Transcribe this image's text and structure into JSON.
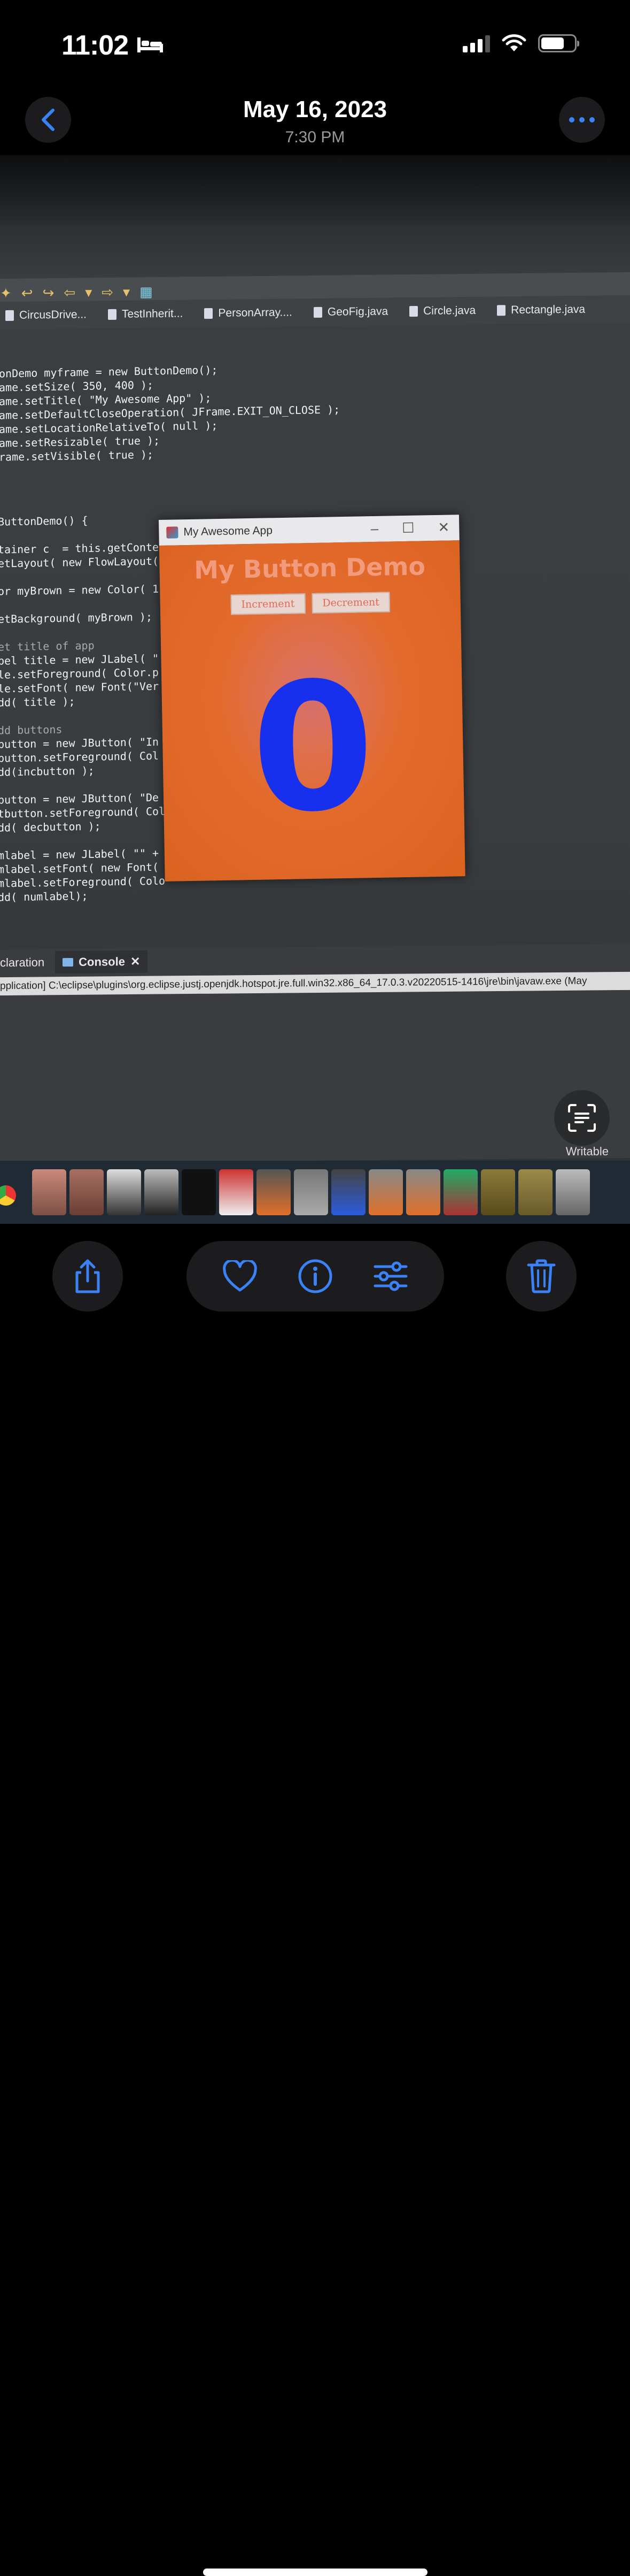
{
  "status_bar": {
    "time": "11:02"
  },
  "header": {
    "date": "May 16, 2023",
    "time": "7:30 PM"
  },
  "photo": {
    "ide_tabs": [
      "CircusDrive...",
      "TestInherit...",
      "PersonArray....",
      "GeoFig.java",
      "Circle.java",
      "Rectangle.java"
    ],
    "code_top": [
      "onDemo myframe = new ButtonDemo();",
      "ame.setSize( 350, 400 );",
      "ame.setTitle( \"My Awesome App\" );",
      "ame.setDefaultCloseOperation( JFrame.EXIT_ON_CLOSE );",
      "ame.setLocationRelativeTo( null );",
      "ame.setResizable( true );",
      "rame.setVisible( true );"
    ],
    "code_left": [
      "ButtonDemo() {",
      "",
      "tainer c  = this.getConte",
      "etLayout( new FlowLayout(",
      "",
      "or myBrown = new Color( 1",
      "",
      "etBackground( myBrown );",
      "",
      "et title of app",
      "bel title = new JLabel( \"",
      "le.setForeground( Color.p",
      "le.setFont( new Font(\"Ver",
      "dd( title );",
      "",
      "dd buttons",
      "button = new JButton( \"In",
      "button.setForeground( Col",
      "dd(incbutton );",
      "",
      "button = new JButton( \"De",
      "tbutton.setForeground( Col",
      "dd( decbutton );",
      "",
      "mlabel = new JLabel( \"\" + ",
      "mlabel.setFont( new Font(",
      "mlabel.setForeground( Colo",
      "dd( numlabel);"
    ],
    "java_window": {
      "title": "My Awesome App",
      "heading": "My Button Demo",
      "increment_label": "Increment",
      "decrement_label": "Decrement",
      "number": "0"
    },
    "console": {
      "tab_prev": "claration",
      "tab_active": "Console",
      "path": "pplication] C:\\eclipse\\plugins\\org.eclipse.justj.openjdk.hotspot.jre.full.win32.x86_64_17.0.3.v20220515-1416\\jre\\bin\\javaw.exe  (May"
    },
    "writable_label": "Writable"
  },
  "colors": {
    "accent": "#3b82f6",
    "java_bg": "#e06727",
    "java_number": "#1730ee"
  },
  "icons": {
    "back": "chevron-left-icon",
    "more": "ellipsis-icon",
    "share": "share-icon",
    "favorite": "heart-icon",
    "info": "info-icon",
    "adjust": "sliders-icon",
    "delete": "trash-icon",
    "live_text": "live-text-icon"
  }
}
